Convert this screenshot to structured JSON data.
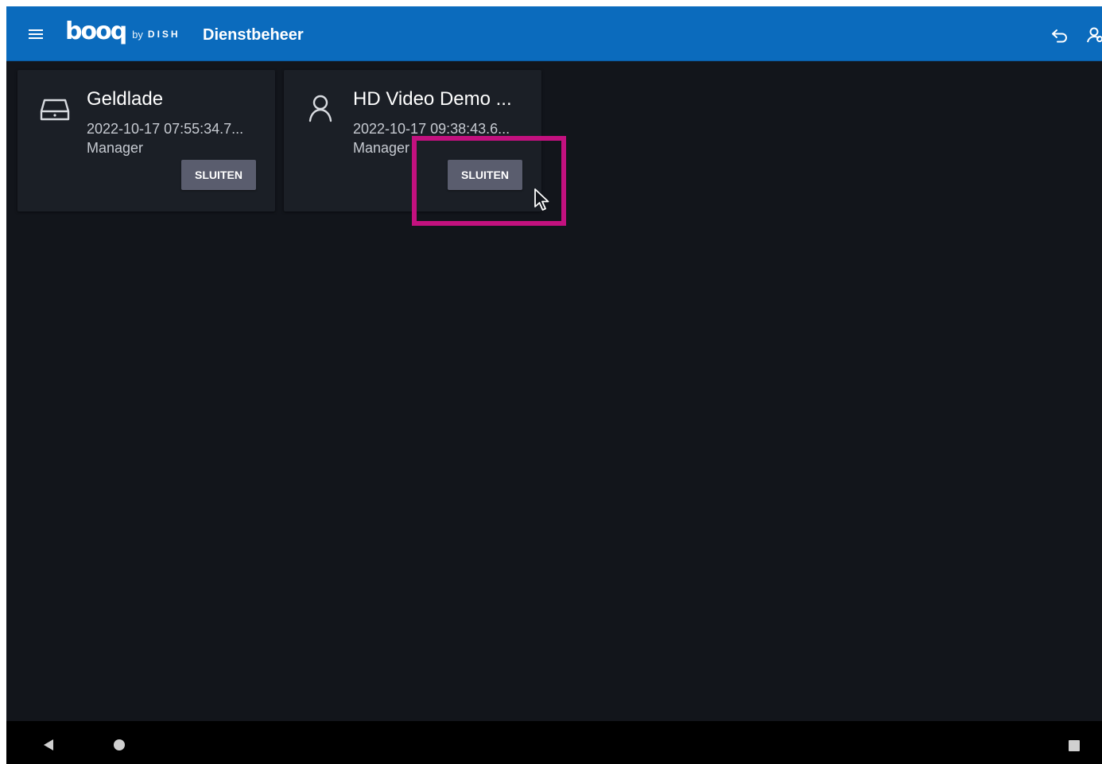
{
  "app": {
    "logo_word": "booq",
    "logo_by": "by",
    "logo_dish": "DISH",
    "title": "Dienstbeheer"
  },
  "icons": {
    "menu": "menu-icon",
    "undo": "undo-arrow-icon",
    "overflow": "user-settings-icon",
    "drawer": "cash-drawer-icon",
    "person": "person-icon",
    "back": "back-triangle-icon",
    "home": "home-circle-icon",
    "recents": "recents-square-icon"
  },
  "cards": [
    {
      "title": "Geldlade",
      "date": "2022-10-17 07:55:34.7...",
      "role": "Manager",
      "button_label": "SLUITEN"
    },
    {
      "title": "HD Video Demo ...",
      "date": "2022-10-17 09:38:43.6...",
      "role": "Manager",
      "button_label": "SLUITEN"
    }
  ],
  "colors": {
    "appbar": "#0b6bbd",
    "background": "#12151b",
    "card": "#1b1f26",
    "button": "#5a5d6e",
    "highlight": "#c3117f"
  }
}
